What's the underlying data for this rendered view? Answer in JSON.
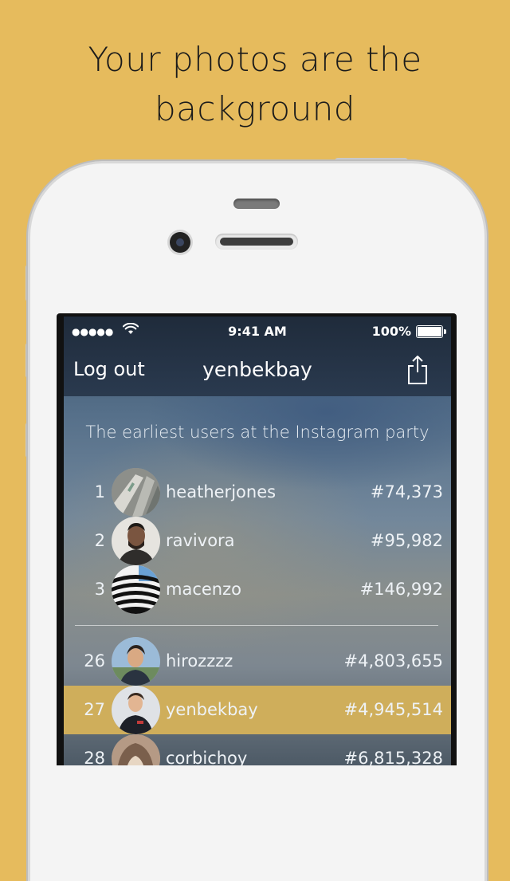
{
  "headline": {
    "line1": "Your photos are the",
    "line2": "background"
  },
  "status_bar": {
    "time": "9:41 AM",
    "battery": "100%"
  },
  "navbar": {
    "left_button": "Log out",
    "title": "yenbekbay"
  },
  "subtitle": "The earliest users at the Instagram party",
  "top_users": [
    {
      "rank": "1",
      "username": "heatherjones",
      "number": "#74,373"
    },
    {
      "rank": "2",
      "username": "ravivora",
      "number": "#95,982"
    },
    {
      "rank": "3",
      "username": "macenzo",
      "number": "#146,992"
    }
  ],
  "nearby_users": [
    {
      "rank": "26",
      "username": "hirozzzz",
      "number": "#4,803,655"
    },
    {
      "rank": "27",
      "username": "yenbekbay",
      "number": "#4,945,514",
      "highlighted": true
    },
    {
      "rank": "28",
      "username": "corbichoy",
      "number": "#6,815,328"
    }
  ],
  "colors": {
    "background": "#e6bb5d",
    "highlight": "#cfae5b",
    "navbar": "#1f2b3b"
  },
  "icons": [
    "signal-dots-icon",
    "wifi-icon",
    "battery-icon",
    "share-icon"
  ]
}
